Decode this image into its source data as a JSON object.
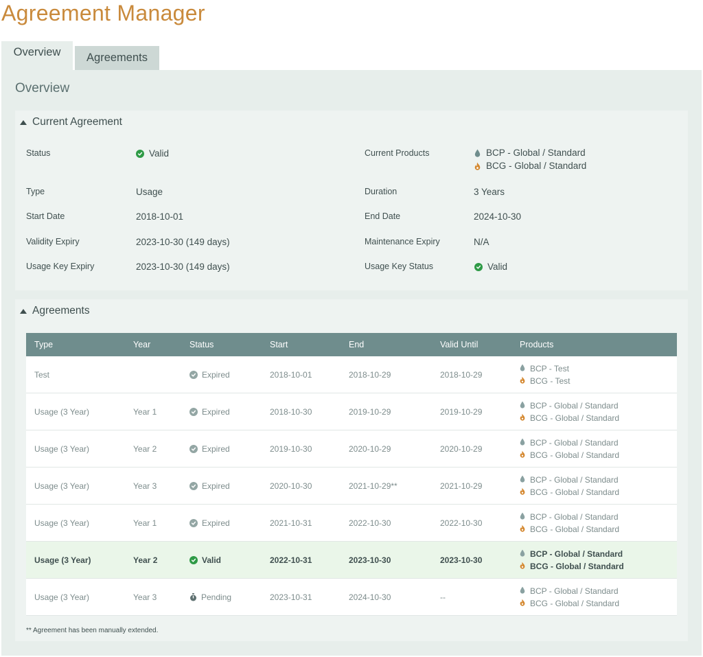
{
  "app": {
    "title": "Agreement Manager"
  },
  "tabs": [
    {
      "label": "Overview",
      "active": true
    },
    {
      "label": "Agreements",
      "active": false
    }
  ],
  "overview": {
    "title": "Overview",
    "current_agreement": {
      "section_label": "Current Agreement",
      "status": {
        "label": "Status",
        "value": "Valid",
        "icon": "check-circle-icon"
      },
      "type": {
        "label": "Type",
        "value": "Usage"
      },
      "start_date": {
        "label": "Start Date",
        "value": "2018-10-01"
      },
      "validity_expiry": {
        "label": "Validity Expiry",
        "value": "2023-10-30 (149 days)"
      },
      "usage_key_expiry": {
        "label": "Usage Key Expiry",
        "value": "2023-10-30 (149 days)"
      },
      "current_products": {
        "label": "Current Products",
        "items": [
          {
            "text": "BCP - Global / Standard",
            "icon": "water-drop-icon"
          },
          {
            "text": "BCG - Global / Standard",
            "icon": "flame-icon"
          }
        ]
      },
      "duration": {
        "label": "Duration",
        "value": "3 Years"
      },
      "end_date": {
        "label": "End Date",
        "value": "2024-10-30"
      },
      "maintenance_expiry": {
        "label": "Maintenance Expiry",
        "value": "N/A"
      },
      "usage_key_status": {
        "label": "Usage Key Status",
        "value": "Valid",
        "icon": "check-circle-icon"
      }
    },
    "agreements": {
      "section_label": "Agreements",
      "columns": [
        "Type",
        "Year",
        "Status",
        "Start",
        "End",
        "Valid Until",
        "Products"
      ],
      "rows": [
        {
          "type": "Test",
          "year": "",
          "status": "Expired",
          "start": "2018-10-01",
          "end": "2018-10-29",
          "valid_until": "2018-10-29",
          "products": [
            "BCP - Test",
            "BCG - Test"
          ]
        },
        {
          "type": "Usage (3 Year)",
          "year": "Year 1",
          "status": "Expired",
          "start": "2018-10-30",
          "end": "2019-10-29",
          "valid_until": "2019-10-29",
          "products": [
            "BCP - Global / Standard",
            "BCG - Global / Standard"
          ]
        },
        {
          "type": "Usage (3 Year)",
          "year": "Year 2",
          "status": "Expired",
          "start": "2019-10-30",
          "end": "2020-10-29",
          "valid_until": "2020-10-29",
          "products": [
            "BCP - Global / Standard",
            "BCG - Global / Standard"
          ]
        },
        {
          "type": "Usage (3 Year)",
          "year": "Year 3",
          "status": "Expired",
          "start": "2020-10-30",
          "end": "2021-10-29**",
          "valid_until": "2021-10-29",
          "products": [
            "BCP - Global / Standard",
            "BCG - Global / Standard"
          ]
        },
        {
          "type": "Usage (3 Year)",
          "year": "Year 1",
          "status": "Expired",
          "start": "2021-10-31",
          "end": "2022-10-30",
          "valid_until": "2022-10-30",
          "products": [
            "BCP - Global / Standard",
            "BCG - Global / Standard"
          ]
        },
        {
          "type": "Usage (3 Year)",
          "year": "Year 2",
          "status": "Valid",
          "start": "2022-10-31",
          "end": "2023-10-30",
          "valid_until": "2023-10-30",
          "products": [
            "BCP - Global / Standard",
            "BCG - Global / Standard"
          ],
          "current": true
        },
        {
          "type": "Usage (3 Year)",
          "year": "Year 3",
          "status": "Pending",
          "start": "2023-10-31",
          "end": "2024-10-30",
          "valid_until": "--",
          "products": [
            "BCP - Global / Standard",
            "BCG - Global / Standard"
          ]
        }
      ],
      "footnote": "** Agreement has been manually extended."
    }
  },
  "colors": {
    "brand": "#c98a3c",
    "panel_bg": "#e7eeeb",
    "card_bg": "#eef3f1",
    "table_header": "#6f8d8d",
    "valid_green": "#2e9a46",
    "expired_grey": "#93a6a4",
    "current_row": "#eaf6e9",
    "drop_icon": "#6f8d8d",
    "flame_icon": "#d4872e"
  }
}
